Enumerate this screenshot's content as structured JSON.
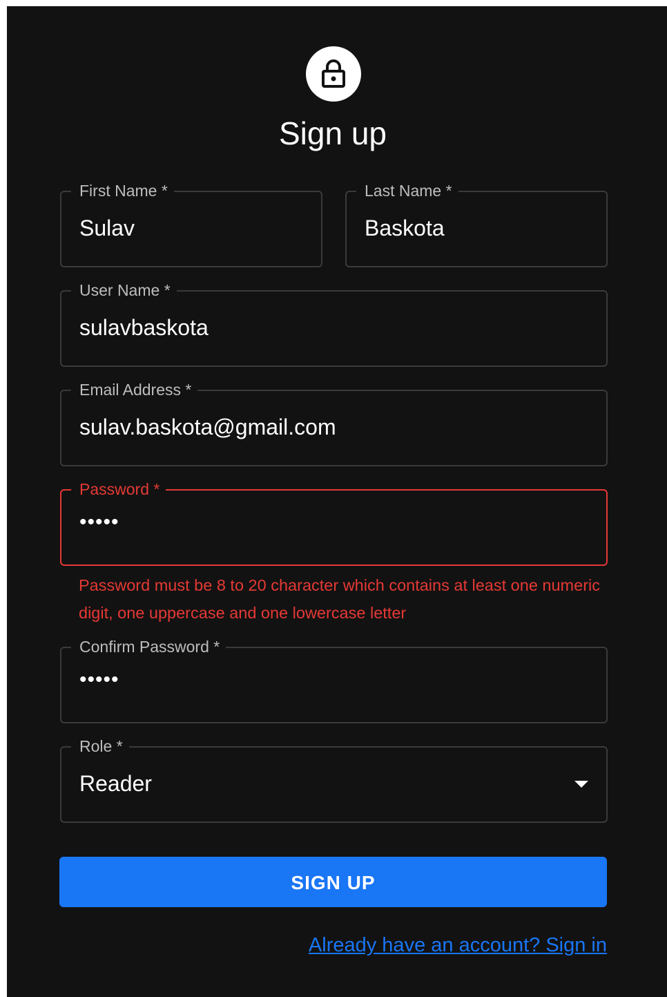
{
  "header": {
    "icon": "lock-icon",
    "title": "Sign up"
  },
  "form": {
    "first_name": {
      "label": "First Name *",
      "value": "Sulav"
    },
    "last_name": {
      "label": "Last Name *",
      "value": "Baskota"
    },
    "user_name": {
      "label": "User Name *",
      "value": "sulavbaskota"
    },
    "email": {
      "label": "Email Address *",
      "value": "sulav.baskota@gmail.com"
    },
    "password": {
      "label": "Password *",
      "value": "•••••",
      "error": "Password must be 8 to 20 character which contains at least one numeric digit, one uppercase and one lowercase letter"
    },
    "confirm_password": {
      "label": "Confirm Password *",
      "value": "•••••"
    },
    "role": {
      "label": "Role *",
      "value": "Reader"
    }
  },
  "actions": {
    "submit_label": "SIGN UP",
    "signin_link": "Already have an account? Sign in"
  },
  "colors": {
    "background": "#121212",
    "primary": "#1976f5",
    "error": "#e53935",
    "border": "#3b3b3b"
  }
}
